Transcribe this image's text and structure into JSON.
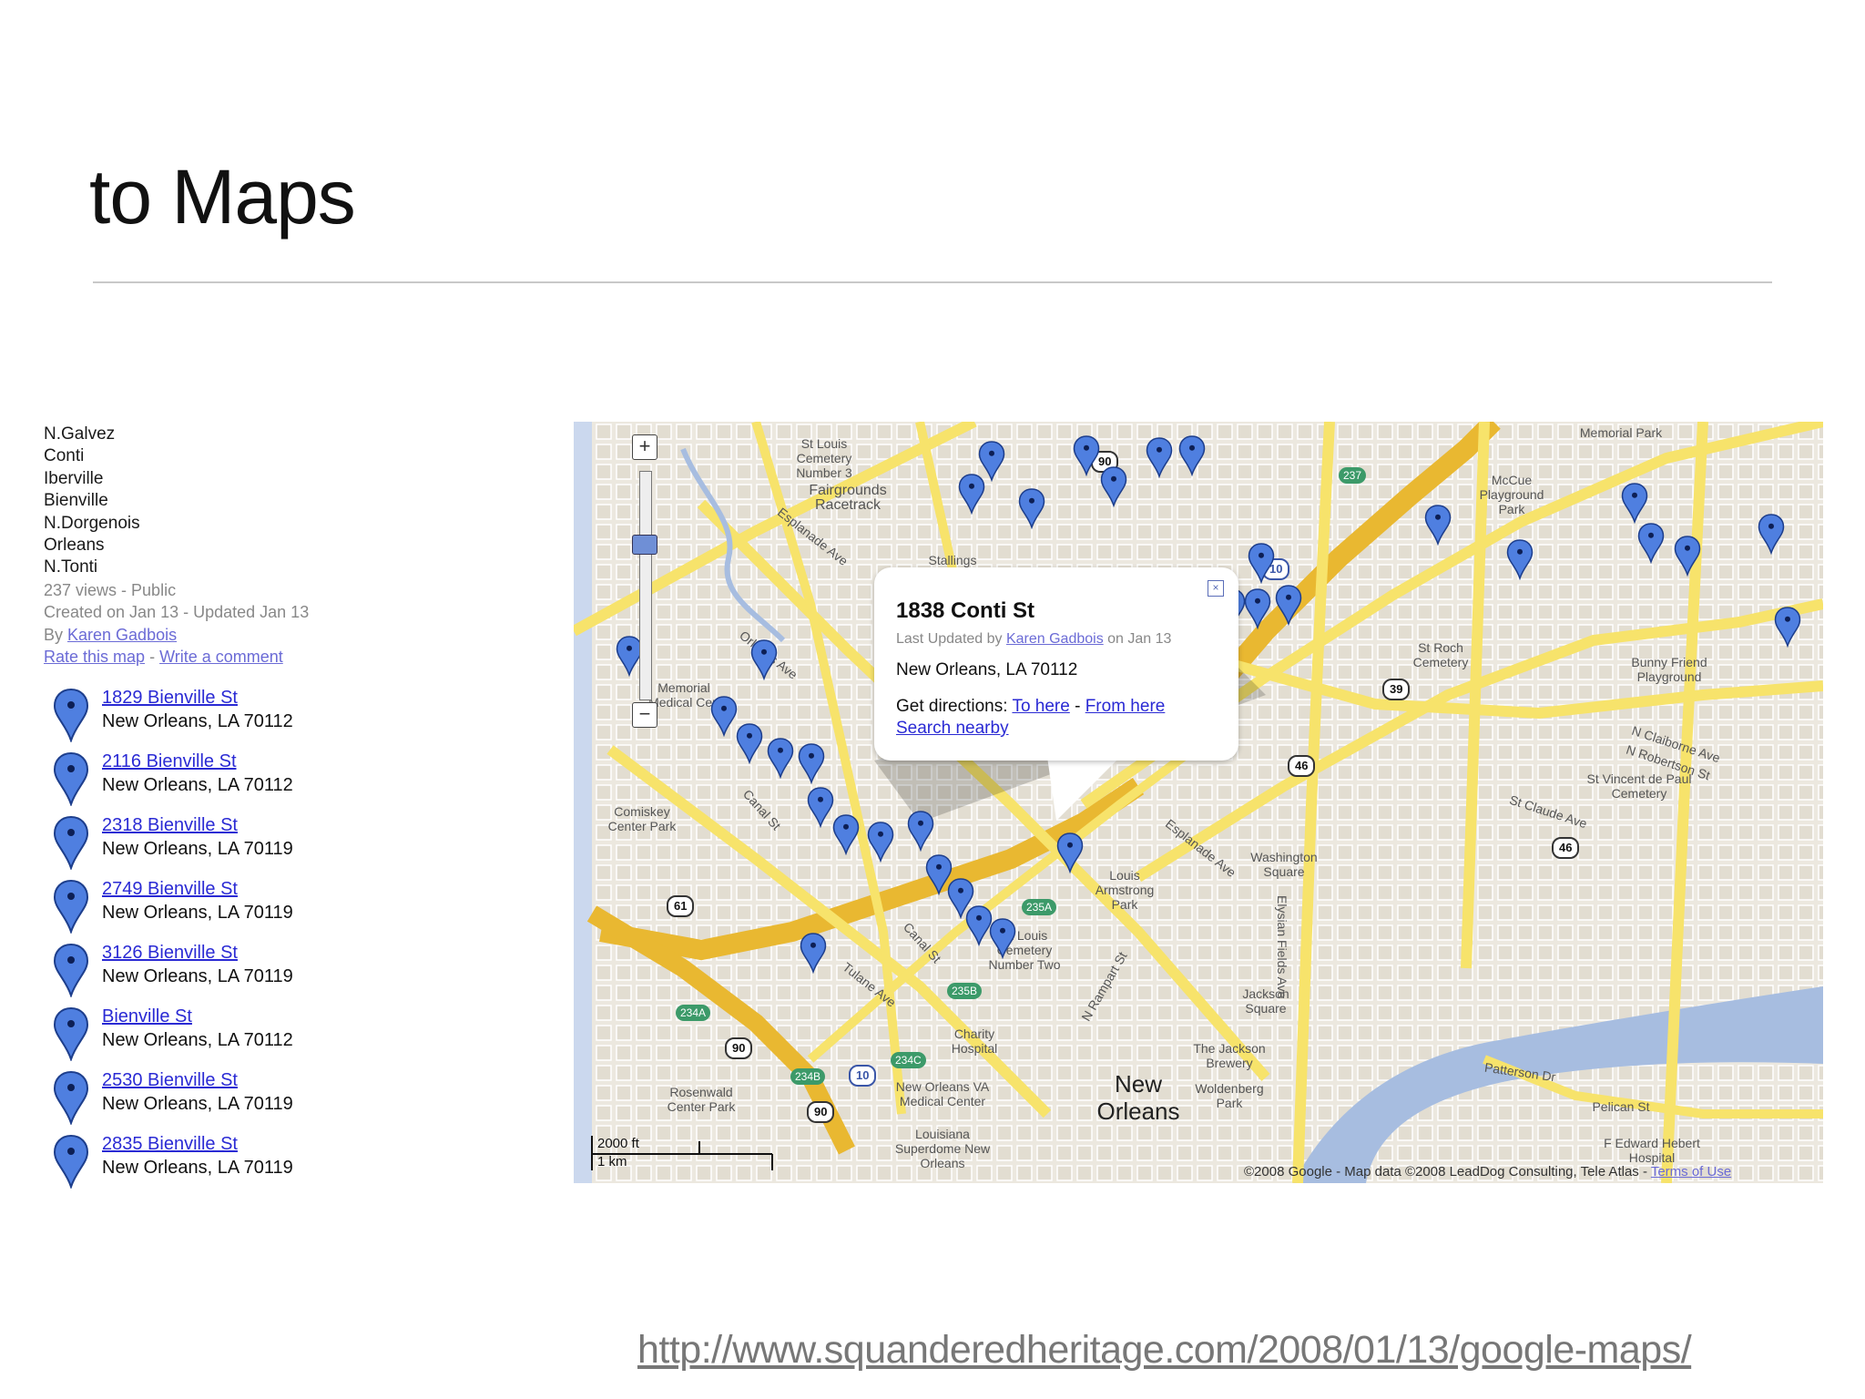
{
  "slide": {
    "title": "to Maps",
    "source_url": "http://www.squanderedheritage.com/2008/01/13/google-maps/"
  },
  "sidebar": {
    "description_lines": [
      "N.Galvez",
      "Conti",
      "Iberville",
      "Bienville",
      "N.Dorgenois",
      "Orleans",
      "N.Tonti"
    ],
    "views": "237 views - Public",
    "created": "Created on Jan 13 - Updated Jan 13",
    "by_prefix": "By ",
    "author": "Karen Gadbois",
    "rate_link": "Rate this map",
    "separator": " - ",
    "comment_link": "Write a comment",
    "results": [
      {
        "address": "1829 Bienville St",
        "city": "New Orleans, LA 70112"
      },
      {
        "address": "2116 Bienville St",
        "city": "New Orleans, LA 70112"
      },
      {
        "address": "2318 Bienville St",
        "city": "New Orleans, LA 70119"
      },
      {
        "address": "2749 Bienville St",
        "city": "New Orleans, LA 70119"
      },
      {
        "address": "3126 Bienville St",
        "city": "New Orleans, LA 70119"
      },
      {
        "address": "Bienville St",
        "city": "New Orleans, LA 70112"
      },
      {
        "address": "2530 Bienville St",
        "city": "New Orleans, LA 70119"
      },
      {
        "address": "2835 Bienville St",
        "city": "New Orleans, LA 70119"
      }
    ]
  },
  "map": {
    "popup": {
      "title": "1838 Conti St",
      "updated_prefix": "Last Updated by ",
      "updated_author": "Karen Gadbois",
      "updated_suffix": " on Jan 13",
      "city": "New Orleans, LA 70112",
      "directions_label": "Get directions: ",
      "to_here": "To here",
      "dash": " - ",
      "from_here": "From here",
      "search_nearby": "Search nearby",
      "close": "×"
    },
    "labels": {
      "st_louis_cem3": "St Louis Cemetery Number 3",
      "fairgrounds": "Fairgrounds Racetrack",
      "memorial_park": "Memorial Park",
      "mccue": "McCue Playground Park",
      "st_roch_cem": "St Roch Cemetery",
      "bunny_friend": "Bunny Friend Playground",
      "st_vincent": "St Vincent de Paul Cemetery",
      "comiskey": "Comiskey Center Park",
      "memorial_med": "Memorial Medical Cen",
      "louis_armstrong": "Louis Armstrong Park",
      "washington_sq": "Washington Square",
      "jackson_sq": "Jackson Square",
      "jackson_brewery": "The Jackson Brewery",
      "woldenberg": "Woldenberg Park",
      "st_louis_cem2": "St Louis Cemetery Number Two",
      "charity": "Charity Hospital",
      "va_med": "New Orleans VA Medical Center",
      "superdome": "Louisiana Superdome New Orleans",
      "rosenwald": "Rosenwald Center Park",
      "stallings": "Stallings",
      "f_edward": "F Edward Hebert Hospital",
      "pelican": "Pelican St",
      "city_name": "New Orleans",
      "esplanade": "Esplanade Ave",
      "canal": "Canal St",
      "claiborne": "N Claiborne Ave",
      "robertson": "N Robertson St",
      "st_claude": "St Claude Ave",
      "tulane": "Tulane Ave",
      "patterson": "Patterson Dr",
      "elysian": "Elysian Fields Ave",
      "rampart": "N Rampart St",
      "orleans": "Orleans Ave"
    },
    "shields": [
      "90",
      "237",
      "10",
      "39",
      "46",
      "46",
      "61",
      "90",
      "90",
      "10",
      "235A",
      "235B",
      "234A",
      "234B",
      "234C"
    ],
    "scale_top": "2000 ft",
    "scale_bottom": "1 km",
    "copyright_text": "©2008 Google - Map data ©2008 LeadDog Consulting, Tele Atlas - ",
    "terms_link": "Terms of Use",
    "colors": {
      "road_major": "#f7e36b",
      "highway": "#e9b831",
      "water": "#a7bde0",
      "land": "#ece8df",
      "pin": "#4f7fe0"
    }
  }
}
